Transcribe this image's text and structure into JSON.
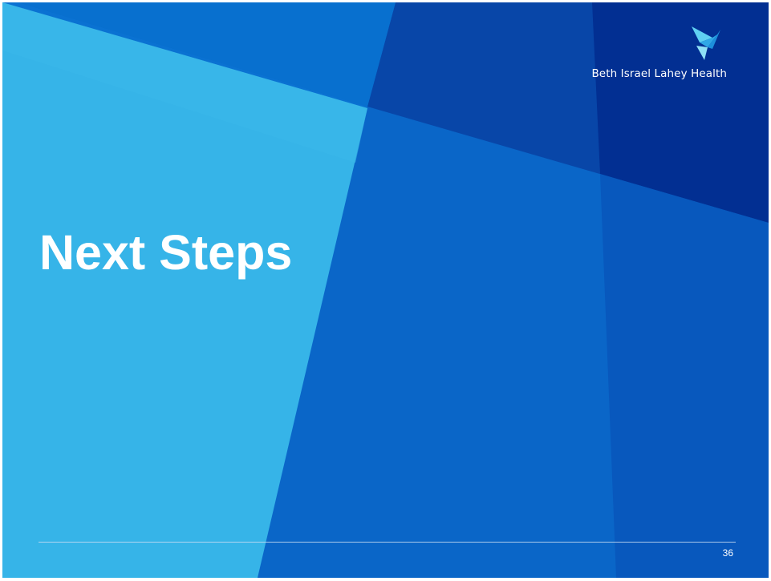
{
  "slide": {
    "title": "Next Steps",
    "page_number": "36"
  },
  "logo": {
    "name": "Beth Israel Lahey Health",
    "icon": "bird-icon"
  },
  "colors": {
    "light_panel": "#36b4e8",
    "mid_blue": "#0b6ccb",
    "deep_blue": "#0841a6",
    "navy": "#002f93",
    "text": "#ffffff"
  }
}
